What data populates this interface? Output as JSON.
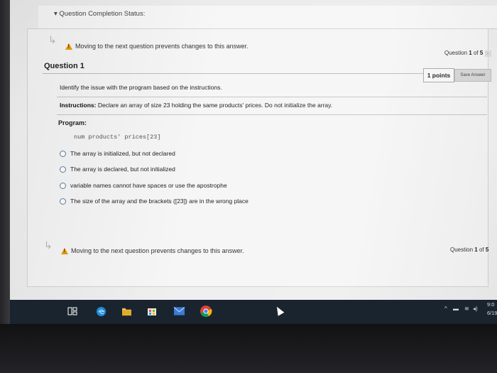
{
  "status": {
    "label": "▾ Question Completion Status:"
  },
  "warnings": {
    "text": "Moving to the next question prevents changes to this answer.",
    "icon": "warning-icon",
    "arrow_icon": "return-arrow-icon"
  },
  "question_nav": {
    "prefix": "Question",
    "current": "1",
    "of": "of",
    "total": "5",
    "next_icon": "chevron-right-icon"
  },
  "question": {
    "title": "Question 1",
    "points": "1 points",
    "save_label": "Save Answer",
    "prompt": "Identify the issue with the program based on the instructions.",
    "instructions_label": "Instructions:",
    "instructions_text": " Declare an array of size 23 holding the same products' prices. Do not initialize the array.",
    "program_label": "Program:",
    "code": "num products' prices[23]",
    "options": [
      "The array is initialized, but not declared",
      "The array is declared, but not initialized",
      "variable names cannot have spaces or use the apostrophe",
      "The size of the array and the brackets ([23]) are in the wrong place"
    ]
  },
  "taskbar": {
    "icons": [
      "task-view-icon",
      "edge-icon",
      "file-explorer-icon",
      "store-icon",
      "mail-icon",
      "chrome-icon"
    ],
    "tray_icons": [
      "chevron-up-icon",
      "battery-icon",
      "wifi-icon",
      "volume-icon"
    ],
    "clock_time": "9:0",
    "clock_date": "6/19"
  },
  "colors": {
    "taskbar": "#19242f",
    "warning": "#e0a000",
    "radio_border": "#5a7fa5"
  }
}
